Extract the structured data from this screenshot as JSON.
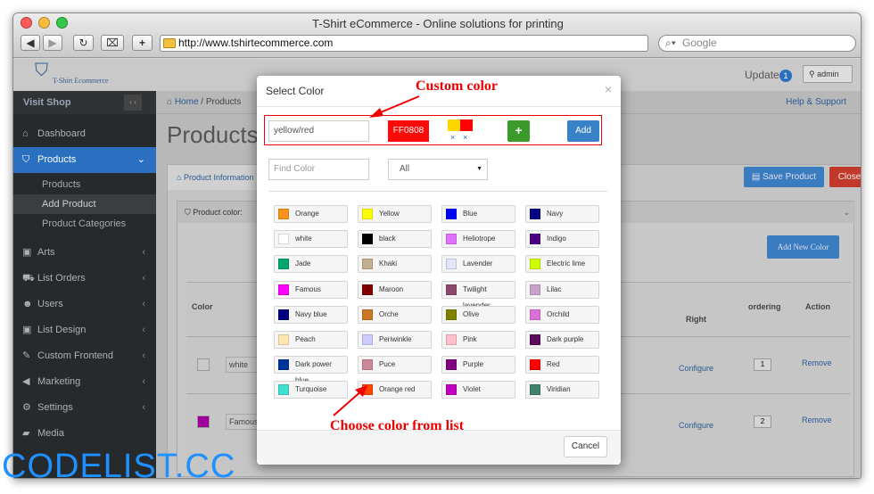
{
  "browser": {
    "title": "T-Shirt eCommerce - Online solutions for printing",
    "url": "http://www.tshirtecommerce.com",
    "search_placeholder": "Google"
  },
  "app": {
    "logo_text": "T-Shirt Ecommerce",
    "update_label": "Update",
    "update_count": "1",
    "user_label": "admin",
    "visit_shop": "Visit Shop",
    "breadcrumb_home": "Home",
    "breadcrumb_products": "Products",
    "help_support": "Help & Support",
    "page_title": "Products"
  },
  "sidebar": {
    "items": [
      {
        "label": "Dashboard",
        "icon": "home-icon"
      },
      {
        "label": "Products",
        "icon": "shirt-icon"
      },
      {
        "label": "Arts",
        "icon": "image-icon"
      },
      {
        "label": "List Orders",
        "icon": "cart-icon"
      },
      {
        "label": "Users",
        "icon": "users-icon"
      },
      {
        "label": "List Design",
        "icon": "picture-icon"
      },
      {
        "label": "Custom Frontend",
        "icon": "pencil-icon"
      },
      {
        "label": "Marketing",
        "icon": "bullhorn-icon"
      },
      {
        "label": "Settings",
        "icon": "gear-icon"
      },
      {
        "label": "Media",
        "icon": "folder-icon"
      }
    ],
    "subitems": [
      "Products",
      "Add Product",
      "Product Categories"
    ]
  },
  "page": {
    "tab_product_info": "Product Information",
    "save_product": "Save Product",
    "close": "Close",
    "product_color": "Product color:",
    "add_new_color": "Add New Color",
    "table_headers": [
      "Color",
      "Right",
      "ordering",
      "Action"
    ],
    "rows": [
      {
        "name": "white",
        "configure": "Configure",
        "ordering": "1",
        "action": "Remove",
        "color": "#ffffff"
      },
      {
        "name": "Famous",
        "configure": "Configure",
        "ordering": "2",
        "action": "Remove",
        "color": "#c000c0"
      }
    ]
  },
  "modal": {
    "title": "Select Color",
    "close_glyph": "×",
    "custom_name_value": "yellow/red",
    "hex_value": "FF0808",
    "hex_color": "#ff0808",
    "preview_colors": [
      "#ffd400",
      "#ff0000"
    ],
    "remove_glyph": "×",
    "plus_label": "+",
    "add_label": "Add",
    "find_placeholder": "Find Color",
    "filter_value": "All",
    "cancel_label": "Cancel",
    "colors": [
      {
        "name": "Orange",
        "hex": "#f7941d"
      },
      {
        "name": "Yellow",
        "hex": "#ffff00"
      },
      {
        "name": "Blue",
        "hex": "#0000ff"
      },
      {
        "name": "Navy",
        "hex": "#000080"
      },
      {
        "name": "white",
        "hex": "#ffffff"
      },
      {
        "name": "black",
        "hex": "#000000"
      },
      {
        "name": "Heliotrope",
        "hex": "#df73ff"
      },
      {
        "name": "Indigo",
        "hex": "#4b0082"
      },
      {
        "name": "Jade",
        "hex": "#00a86b"
      },
      {
        "name": "Khaki",
        "hex": "#c3b091"
      },
      {
        "name": "Lavender",
        "hex": "#e6e6fa"
      },
      {
        "name": "Electric lime",
        "hex": "#ccff00"
      },
      {
        "name": "Famous",
        "hex": "#ff00ff"
      },
      {
        "name": "Maroon",
        "hex": "#800000"
      },
      {
        "name": "Twilight lavender",
        "hex": "#8a496b"
      },
      {
        "name": "Lilac",
        "hex": "#c8a2c8"
      },
      {
        "name": "Navy blue",
        "hex": "#000080"
      },
      {
        "name": "Orche",
        "hex": "#cc7722"
      },
      {
        "name": "Olive",
        "hex": "#808000"
      },
      {
        "name": "Orchild",
        "hex": "#da70d6"
      },
      {
        "name": "Peach",
        "hex": "#ffe5b4"
      },
      {
        "name": "Periwinkle",
        "hex": "#ccccff"
      },
      {
        "name": "Pink",
        "hex": "#ffc0cb"
      },
      {
        "name": "Dark purple",
        "hex": "#5b0a5b"
      },
      {
        "name": "Dark power blue",
        "hex": "#003399"
      },
      {
        "name": "Puce",
        "hex": "#cc8899"
      },
      {
        "name": "Purple",
        "hex": "#800080"
      },
      {
        "name": "Red",
        "hex": "#ff0000"
      },
      {
        "name": "Turquoise",
        "hex": "#40e0d0"
      },
      {
        "name": "Orange red",
        "hex": "#ff4500"
      },
      {
        "name": "Violet",
        "hex": "#c000c0"
      },
      {
        "name": "Viridian",
        "hex": "#40826d"
      }
    ]
  },
  "annotations": {
    "custom_color": "Custom color",
    "choose_from_list": "Choose color from list"
  },
  "watermark": "CODELIST.CC"
}
